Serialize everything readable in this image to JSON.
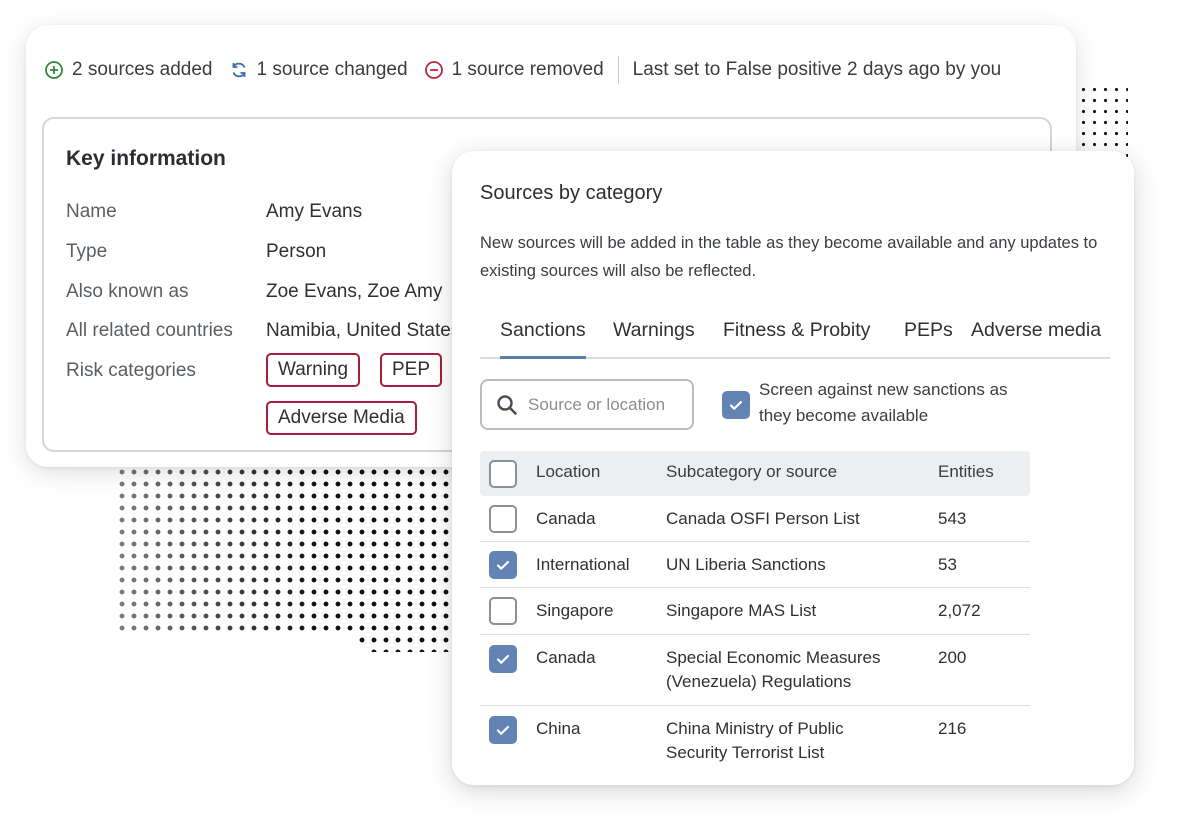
{
  "status": {
    "added": "2 sources added",
    "changed": "1 source changed",
    "removed": "1 source removed",
    "last_set": "Last set to False positive 2 days ago by you"
  },
  "key_info": {
    "title": "Key information",
    "fields": [
      {
        "label": "Name",
        "value": "Amy Evans"
      },
      {
        "label": "Type",
        "value": "Person"
      },
      {
        "label": "Also known as",
        "value": "Zoe Evans, Zoe Amy"
      },
      {
        "label": "All related countries",
        "value": "Namibia, United States"
      },
      {
        "label": "Risk categories",
        "value": ""
      }
    ],
    "risk_tags": [
      "Warning",
      "PEP",
      "Adverse Media"
    ]
  },
  "sources": {
    "title": "Sources by category",
    "description": "New sources will be added in the table as they become available and any updates to existing sources will also be reflected.",
    "tabs": [
      "Sanctions",
      "Warnings",
      "Fitness & Probity",
      "PEPs",
      "Adverse media"
    ],
    "active_tab": "Sanctions",
    "search_placeholder": "Source or location",
    "screen_new_label": "Screen against new sanctions as they become available",
    "screen_new_checked": true,
    "table": {
      "headers": [
        "Location",
        "Subcategory or source",
        "Entities"
      ],
      "rows": [
        {
          "checked": false,
          "location": "Canada",
          "source": "Canada OSFI Person List",
          "entities": "543"
        },
        {
          "checked": true,
          "location": "International",
          "source": "UN Liberia Sanctions",
          "entities": "53"
        },
        {
          "checked": false,
          "location": "Singapore",
          "source": "Singapore MAS List",
          "entities": "2,072"
        },
        {
          "checked": true,
          "location": "Canada",
          "source": "Special Economic Measures (Venezuela) Regulations",
          "entities": "200"
        },
        {
          "checked": true,
          "location": "China",
          "source": "China Ministry of Public Security Terrorist List",
          "entities": "216"
        }
      ]
    }
  },
  "colors": {
    "added": "#2e8b3a",
    "changed": "#3d6aa8",
    "removed": "#c0263f",
    "tag_border": "#a61e3c",
    "checkbox": "#6283b4",
    "tab_underline": "#5b7fae"
  },
  "icons": {
    "added": "plus-circle-icon",
    "changed": "refresh-icon",
    "removed": "minus-circle-icon",
    "search": "search-icon",
    "check": "checkmark-icon"
  }
}
